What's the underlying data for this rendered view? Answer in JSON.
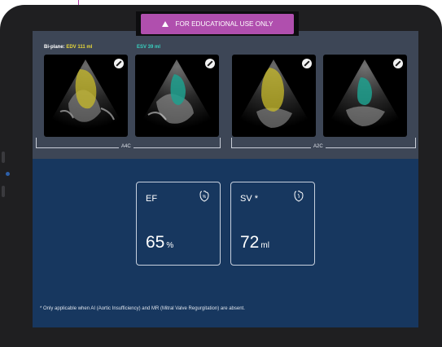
{
  "banner": {
    "text": "FOR EDUCATIONAL USE ONLY",
    "icon": "warning-triangle-icon"
  },
  "volumes": {
    "biplane_label": "Bi-plane:",
    "edv": "EDV 111 ml",
    "esv": "ESV 39 ml"
  },
  "views": {
    "left_group": "A4C",
    "right_group": "A2C"
  },
  "echo_frames": [
    {
      "view": "A4C",
      "phase": "EDV",
      "overlay_color": "#c8bb2a"
    },
    {
      "view": "A4C",
      "phase": "ESV",
      "overlay_color": "#1fa08e"
    },
    {
      "view": "A2C",
      "phase": "EDV",
      "overlay_color": "#c8bb2a"
    },
    {
      "view": "A2C",
      "phase": "ESV",
      "overlay_color": "#1fa08e"
    }
  ],
  "results": [
    {
      "title": "EF",
      "value": "65",
      "unit": "%",
      "icon": "heart-percent-icon"
    },
    {
      "title": "SV *",
      "value": "72",
      "unit": "ml",
      "icon": "heart-icon"
    }
  ],
  "footnote": "* Only applicable when AI (Aortic Insufficiency) and MR (Mitral Valve Regurgitation) are absent.",
  "colors": {
    "banner": "#b04fae",
    "edv": "#e8d83a",
    "esv": "#38d1c0",
    "top_panel": "#3d4656",
    "results_bg": "#17375f"
  }
}
